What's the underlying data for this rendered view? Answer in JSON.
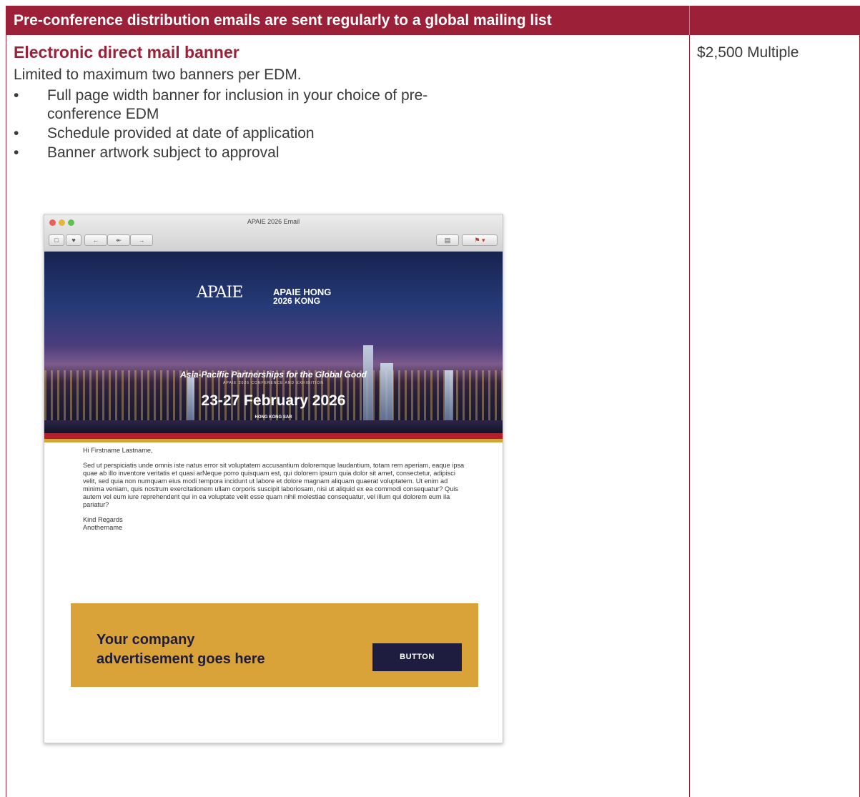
{
  "header": {
    "title": "Pre-conference distribution emails are sent regularly to a global mailing list"
  },
  "item": {
    "title": "Electronic direct mail banner",
    "description": "Limited to maximum two banners per EDM.",
    "price": "$2,500 Multiple",
    "bullet_char": "•",
    "bullets": [
      "Full page width banner for inclusion in your choice of pre-conference EDM",
      "Schedule provided at date of application",
      "Banner artwork subject to approval"
    ]
  },
  "mockup": {
    "window_title": "APAIE 2026 Email",
    "banner": {
      "logo_left": "APAIE",
      "logo_right_line1": "APAIE",
      "logo_right_line2": "HONG",
      "logo_right_line3": "2026",
      "logo_right_line4": "KONG",
      "tagline": "Asia-Pacific Partnerships for the Global Good",
      "subtagline": "APAIE 2026 CONFERENCE AND EXHIBITION",
      "dates": "23-27 February 2026",
      "location": "HONG KONG SAR"
    },
    "email": {
      "greeting": "Hi Firstname Lastname,",
      "body": "Sed ut perspiciatis unde omnis iste natus error sit voluptatem accusantium doloremque laudantium, totam rem aperiam, eaque ipsa quae ab illo inventore veritatis et quasi arNeque porro quisquam est, qui dolorem ipsum quia dolor sit amet, consectetur, adipisci velit, sed quia non numquam eius modi tempora incidunt ut labore et dolore magnam aliquam quaerat voluptatem. Ut enim ad minima veniam, quis nostrum exercitationem ullam corporis suscipit laboriosam, nisi ut aliquid ex ea commodi consequatur? Quis autem vel eum iure reprehenderit qui in ea voluptate velit esse quam nihil molestiae consequatur, vel illum qui dolorem eum ila pariatur?",
      "signoff_line1": "Kind Regards",
      "signoff_line2": "Anothername"
    },
    "ad": {
      "line1": "Your company",
      "line2": "advertisement goes here",
      "button": "BUTTON"
    }
  },
  "colors": {
    "brand": "#9c2138",
    "ad_background": "#d9a339",
    "ad_text": "#1e1c3f"
  }
}
